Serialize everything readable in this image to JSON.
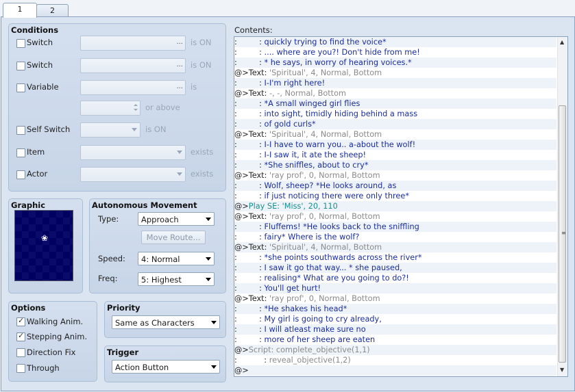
{
  "tabs": [
    "1",
    "2"
  ],
  "conditions": {
    "title": "Conditions",
    "switch1": {
      "label": "Switch",
      "suffix": "is ON"
    },
    "switch2": {
      "label": "Switch",
      "suffix": "is ON"
    },
    "variable": {
      "label": "Variable",
      "suffix": "is",
      "compare_suffix": "or above"
    },
    "self_switch": {
      "label": "Self Switch",
      "suffix": "is ON"
    },
    "item": {
      "label": "Item",
      "suffix": "exists"
    },
    "actor": {
      "label": "Actor",
      "suffix": "exists"
    },
    "ellipsis": "..."
  },
  "graphic": {
    "title": "Graphic",
    "sprite_glyph": "❀"
  },
  "autonomous": {
    "title": "Autonomous Movement",
    "type_label": "Type:",
    "type_value": "Approach",
    "move_route_button": "Move Route...",
    "speed_label": "Speed:",
    "speed_value": "4: Normal",
    "freq_label": "Freq:",
    "freq_value": "5: Highest"
  },
  "options": {
    "title": "Options",
    "items": [
      {
        "label": "Walking Anim.",
        "checked": true
      },
      {
        "label": "Stepping Anim.",
        "checked": true
      },
      {
        "label": "Direction Fix",
        "checked": false
      },
      {
        "label": "Through",
        "checked": false
      }
    ]
  },
  "priority": {
    "title": "Priority",
    "value": "Same as Characters"
  },
  "trigger": {
    "title": "Trigger",
    "value": "Action Button"
  },
  "contents": {
    "label": "Contents:",
    "lines": [
      {
        "prefix": ":         : ",
        "text": "quickly trying to find the voice*",
        "color": "blue"
      },
      {
        "prefix": ":         : ",
        "text": ".... where are you?! Don't hide from me!",
        "color": "blue"
      },
      {
        "prefix": ":         : ",
        "text": "* he says, in worry of hearing voices.*",
        "color": "blue"
      },
      {
        "prefix": "@>Text: ",
        "text": "'Spiritual', 4, Normal, Bottom",
        "color": "gray"
      },
      {
        "prefix": ":         : ",
        "text": "I-I'm right here!",
        "color": "blue"
      },
      {
        "prefix": "@>Text: ",
        "text": "-, -, Normal, Bottom",
        "color": "gray"
      },
      {
        "prefix": ":         : ",
        "text": "*A small winged girl flies",
        "color": "blue"
      },
      {
        "prefix": ":         : ",
        "text": "into sight, timidly hiding behind a mass",
        "color": "blue"
      },
      {
        "prefix": ":         : ",
        "text": "of gold curls*",
        "color": "blue"
      },
      {
        "prefix": "@>Text: ",
        "text": "'Spiritual', 4, Normal, Bottom",
        "color": "gray"
      },
      {
        "prefix": ":         : ",
        "text": "I-I have to warn you.. a-about the wolf!",
        "color": "blue"
      },
      {
        "prefix": ":         : ",
        "text": "I-I saw it, it ate the sheep!",
        "color": "blue"
      },
      {
        "prefix": ":         : ",
        "text": "*She sniffles, about to cry*",
        "color": "blue"
      },
      {
        "prefix": "@>Text: ",
        "text": "'ray prof', 0, Normal, Bottom",
        "color": "gray"
      },
      {
        "prefix": ":         : ",
        "text": "Wolf, sheep? *He looks around, as",
        "color": "blue"
      },
      {
        "prefix": ":         : ",
        "text": "if just noticing there were only three*",
        "color": "blue"
      },
      {
        "prefix": "@>",
        "text": "Play SE: 'Miss', 20, 110",
        "color": "teal"
      },
      {
        "prefix": "@>Text: ",
        "text": "'ray prof', 0, Normal, Bottom",
        "color": "gray"
      },
      {
        "prefix": ":         : ",
        "text": "Fluffems! *He looks back to the sniffling",
        "color": "blue"
      },
      {
        "prefix": ":         : ",
        "text": "fairy* Where is the wolf?",
        "color": "blue"
      },
      {
        "prefix": "@>Text: ",
        "text": "'Spiritual', 4, Normal, Bottom",
        "color": "gray"
      },
      {
        "prefix": ":         : ",
        "text": "*she points southwards across the river*",
        "color": "blue"
      },
      {
        "prefix": ":         : ",
        "text": "I saw it go that way... * she paused,",
        "color": "blue"
      },
      {
        "prefix": ":         : ",
        "text": "realising* What are you going to do?!",
        "color": "blue"
      },
      {
        "prefix": ":         : ",
        "text": "You'll get hurt!",
        "color": "blue"
      },
      {
        "prefix": "@>Text: ",
        "text": "'ray prof', 0, Normal, Bottom",
        "color": "gray"
      },
      {
        "prefix": ":         : ",
        "text": "*He shakes his head*",
        "color": "blue"
      },
      {
        "prefix": ":         : ",
        "text": "My girl is going to cry already,",
        "color": "blue"
      },
      {
        "prefix": ":         : ",
        "text": "I will atleast make sure no",
        "color": "blue"
      },
      {
        "prefix": ":         : ",
        "text": "more of her sheep are eaten",
        "color": "blue"
      },
      {
        "prefix": "@>",
        "text": "Script: complete_objective(1,1)",
        "color": "gray"
      },
      {
        "prefix": ":           : ",
        "text": "reveal_objective(1,2)",
        "color": "gray"
      },
      {
        "prefix": "@>",
        "text": "",
        "color": "black"
      }
    ]
  }
}
